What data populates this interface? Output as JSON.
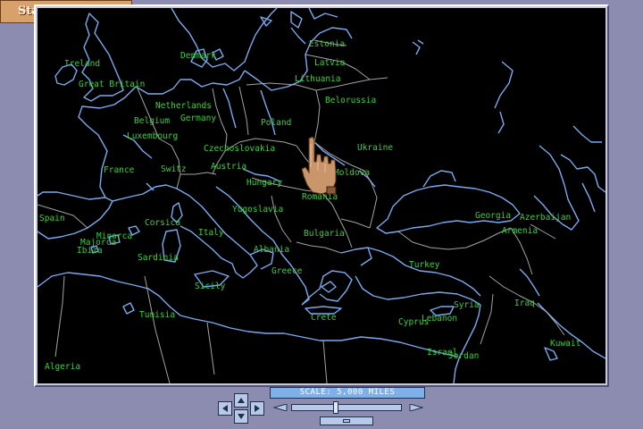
{
  "watermark": "Stare-e-gry.net",
  "scale": {
    "label": "SCALE: 5,000 MILES",
    "zoom_level": 0.38
  },
  "colors": {
    "background": "#8c8cb0",
    "map": "#000000",
    "coast": "#78aaf0",
    "borders": "#b4b4b4",
    "labels": "#37d03a",
    "scale_bar": "#7fb0e8"
  },
  "map": {
    "labels": [
      {
        "id": "estonia",
        "text": "Estonia"
      },
      {
        "id": "latvia",
        "text": "Latvia"
      },
      {
        "id": "lithuania",
        "text": "Lithuania"
      },
      {
        "id": "ireland",
        "text": "Ireland"
      },
      {
        "id": "great-britain",
        "text": "Great Britain"
      },
      {
        "id": "denmark",
        "text": "Denmark"
      },
      {
        "id": "belorussia",
        "text": "Belorussia"
      },
      {
        "id": "netherlands",
        "text": "Netherlands"
      },
      {
        "id": "germany",
        "text": "Germany"
      },
      {
        "id": "poland",
        "text": "Poland"
      },
      {
        "id": "belgium",
        "text": "Belgium"
      },
      {
        "id": "luxembourg",
        "text": "Luxembourg"
      },
      {
        "id": "czechoslovakia",
        "text": "Czechoslovakia"
      },
      {
        "id": "ukraine",
        "text": "Ukraine"
      },
      {
        "id": "france",
        "text": "France"
      },
      {
        "id": "switzerland",
        "text": "Switz"
      },
      {
        "id": "austria",
        "text": "Austria"
      },
      {
        "id": "moldova",
        "text": "Moldova"
      },
      {
        "id": "hungary",
        "text": "Hungary"
      },
      {
        "id": "romania",
        "text": "Romania"
      },
      {
        "id": "spain",
        "text": "Spain"
      },
      {
        "id": "corsica",
        "text": "Corsica"
      },
      {
        "id": "yugoslavia",
        "text": "Yugoslavia"
      },
      {
        "id": "georgia",
        "text": "Georgia"
      },
      {
        "id": "azerbaijan",
        "text": "Azerbaijan"
      },
      {
        "id": "minorca",
        "text": "Minorca"
      },
      {
        "id": "majorca",
        "text": "Majorca"
      },
      {
        "id": "ibiza",
        "text": "Ibiza"
      },
      {
        "id": "italy",
        "text": "Italy"
      },
      {
        "id": "bulgaria",
        "text": "Bulgaria"
      },
      {
        "id": "armenia",
        "text": "Armenia"
      },
      {
        "id": "albania",
        "text": "Albania"
      },
      {
        "id": "sardinia",
        "text": "Sardinia"
      },
      {
        "id": "turkey",
        "text": "Turkey"
      },
      {
        "id": "greece",
        "text": "Greece"
      },
      {
        "id": "sicily",
        "text": "Sicily"
      },
      {
        "id": "syria",
        "text": "Syria"
      },
      {
        "id": "iraq",
        "text": "Iraq"
      },
      {
        "id": "tunisia",
        "text": "Tunisia"
      },
      {
        "id": "crete",
        "text": "Crete"
      },
      {
        "id": "cyprus",
        "text": "Cyprus"
      },
      {
        "id": "lebanon",
        "text": "Lebanon"
      },
      {
        "id": "kuwait",
        "text": "Kuwait"
      },
      {
        "id": "israel",
        "text": "Israel"
      },
      {
        "id": "jordan",
        "text": "Jordan"
      },
      {
        "id": "algeria",
        "text": "Algeria"
      }
    ]
  },
  "controls": {
    "icons": [
      "arrow-left-icon",
      "arrow-up-icon",
      "arrow-down-icon",
      "arrow-right-icon",
      "zoom-out-icon",
      "zoom-in-icon",
      "hand-pointer-icon"
    ]
  }
}
